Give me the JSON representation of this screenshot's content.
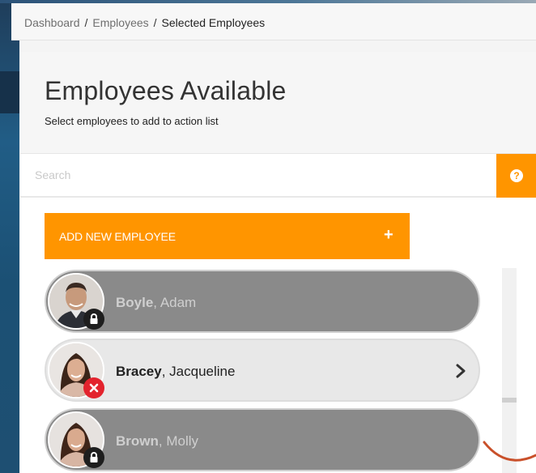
{
  "breadcrumb": {
    "items": [
      {
        "label": "Dashboard"
      },
      {
        "label": "Employees"
      },
      {
        "label": "Selected Employees"
      }
    ],
    "separator": "/"
  },
  "header": {
    "title": "Employees Available",
    "subtitle": "Select employees to add to action list"
  },
  "search": {
    "value": "",
    "placeholder": "Search",
    "help_icon": "question-circle-icon"
  },
  "add_button": {
    "label": "ADD NEW EMPLOYEE",
    "icon_glyph": "+"
  },
  "employees": [
    {
      "last": "Boyle",
      "first": "Adam",
      "state": "locked",
      "badge_icon": "lock-icon"
    },
    {
      "last": "Bracey",
      "first": "Jacqueline",
      "state": "available",
      "badge_icon": "remove-icon"
    },
    {
      "last": "Brown",
      "first": "Molly",
      "state": "locked",
      "badge_icon": "lock-icon"
    }
  ],
  "colors": {
    "accent": "#ff9500",
    "locked_row": "#8a8a8a",
    "available_row": "#e8e8e8",
    "remove_badge": "#e3232d"
  }
}
